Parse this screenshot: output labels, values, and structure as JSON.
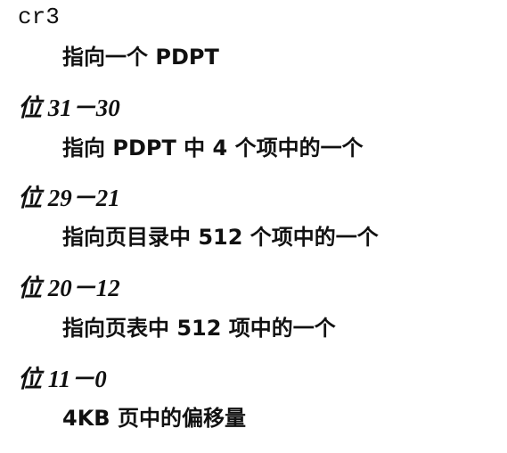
{
  "register": "cr3",
  "register_desc": "指向一个 PDPT",
  "sections": [
    {
      "heading": "位 31－30",
      "desc": "指向 PDPT 中 4 个项中的一个"
    },
    {
      "heading": "位 29－21",
      "desc": "指向页目录中 512 个项中的一个"
    },
    {
      "heading": "位 20－12",
      "desc": "指向页表中 512 项中的一个"
    },
    {
      "heading": "位 11－0",
      "desc": "4KB 页中的偏移量"
    }
  ]
}
